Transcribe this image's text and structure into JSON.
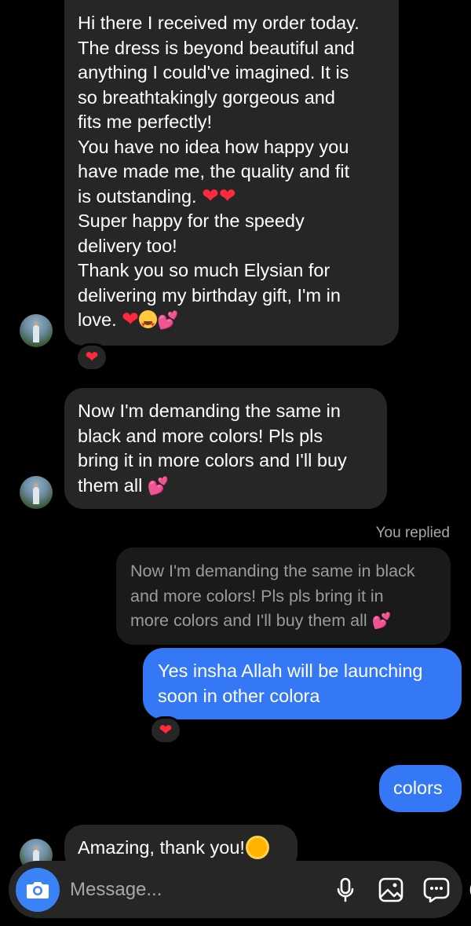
{
  "thread": {
    "message_1": {
      "lines": [
        "Hi there I received my order today.",
        "The dress is beyond beautiful and",
        "anything I could've imagined. It is",
        "so breathtakingly gorgeous and",
        "fits me perfectly!",
        "You have no idea how happy you",
        "have made me, the quality and fit",
        "is outstanding.",
        "Super happy for the speedy",
        "delivery too!",
        "Thank you so much Elysian for",
        "delivering my birthday gift, I'm in",
        "love."
      ],
      "reaction": "❤"
    },
    "message_2": {
      "lines": [
        "Now I'm demanding the same in",
        "black and more colors! Pls pls",
        "bring it in more colors and I'll buy",
        "them all"
      ]
    },
    "reply_label": "You replied",
    "quoted_lines": [
      "Now I'm demanding the same in black",
      "and more colors! Pls pls bring it in",
      "more colors and I'll buy them all"
    ],
    "sent_1": {
      "lines": [
        "Yes insha Allah will be launching",
        "soon in other colora"
      ],
      "reaction": "❤"
    },
    "sent_2": {
      "text": "colors"
    },
    "message_3": {
      "text": "Amazing, thank you!"
    }
  },
  "composer": {
    "placeholder": "Message...",
    "icons": [
      "camera-icon",
      "microphone-icon",
      "gallery-icon",
      "sticker-icon",
      "add-icon"
    ]
  },
  "colors": {
    "background": "#000000",
    "incoming_bubble": "#262626",
    "outgoing_bubble": "#3478f6",
    "camera_button": "#3b82f6",
    "heart": "#ff2a3d"
  }
}
